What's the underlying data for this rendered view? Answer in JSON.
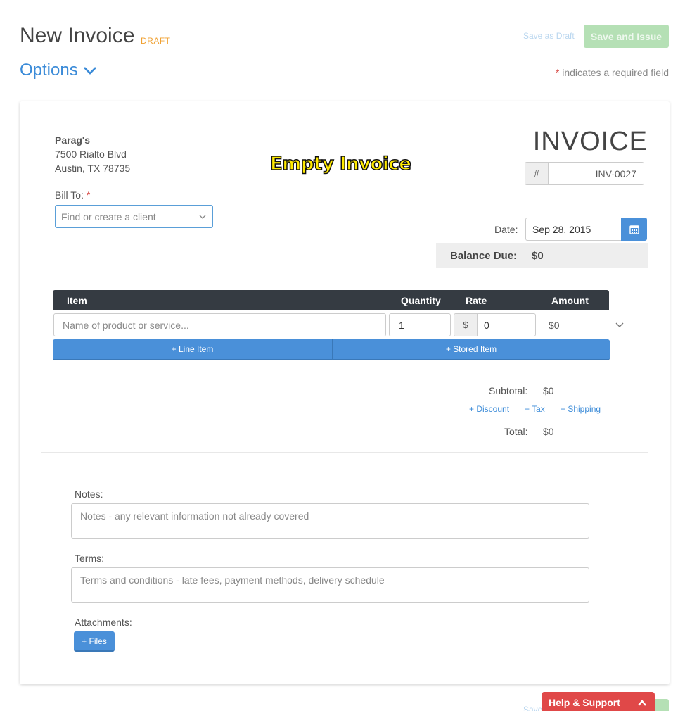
{
  "header": {
    "title": "New Invoice",
    "status": "DRAFT",
    "options_label": "Options",
    "save_draft_label": "Save as Draft",
    "save_issue_label": "Save and Issue",
    "required_star": "*",
    "required_note": " indicates a required field"
  },
  "business": {
    "name": "Parag's",
    "address_line1": "7500 Rialto Blvd",
    "address_line2": "Austin, TX 78735"
  },
  "overlay_label": "Empty Invoice",
  "bill_to": {
    "label": "Bill To: ",
    "required_star": "*",
    "placeholder": "Find or create a client"
  },
  "invoice_meta": {
    "heading": "INVOICE",
    "number_prefix": "#",
    "number": "INV-0027",
    "date_label": "Date:",
    "date": "Sep 28, 2015",
    "balance_label": "Balance Due:",
    "balance_value": "$0"
  },
  "items_table": {
    "columns": [
      "Item",
      "Quantity",
      "Rate",
      "Amount"
    ],
    "row": {
      "name_placeholder": "Name of product or service...",
      "quantity": "1",
      "rate_prefix": "$",
      "rate": "0",
      "amount": "$0"
    },
    "add_line_item": "+ Line Item",
    "add_stored_item": "+ Stored Item"
  },
  "totals": {
    "subtotal_label": "Subtotal:",
    "subtotal_value": "$0",
    "add_discount": "+ Discount",
    "add_tax": "+ Tax",
    "add_shipping": "+ Shipping",
    "total_label": "Total:",
    "total_value": "$0"
  },
  "footer_fields": {
    "notes_label": "Notes:",
    "notes_placeholder": "Notes - any relevant information not already covered",
    "terms_label": "Terms:",
    "terms_placeholder": "Terms and conditions - late fees, payment methods, delivery schedule",
    "attachments_label": "Attachments:",
    "files_button": "+ Files"
  },
  "bottom_bar": {
    "save_draft_label": "Save",
    "help_label": "Help & Support"
  },
  "colors": {
    "accent": "#4a90d9",
    "draft": "#f0a030",
    "save_issue_disabled": "#b5e0b5",
    "help": "#e04848",
    "table_header": "#353b42"
  },
  "icons": [
    "chevron-down-icon",
    "calendar-icon",
    "chevron-up-icon"
  ]
}
